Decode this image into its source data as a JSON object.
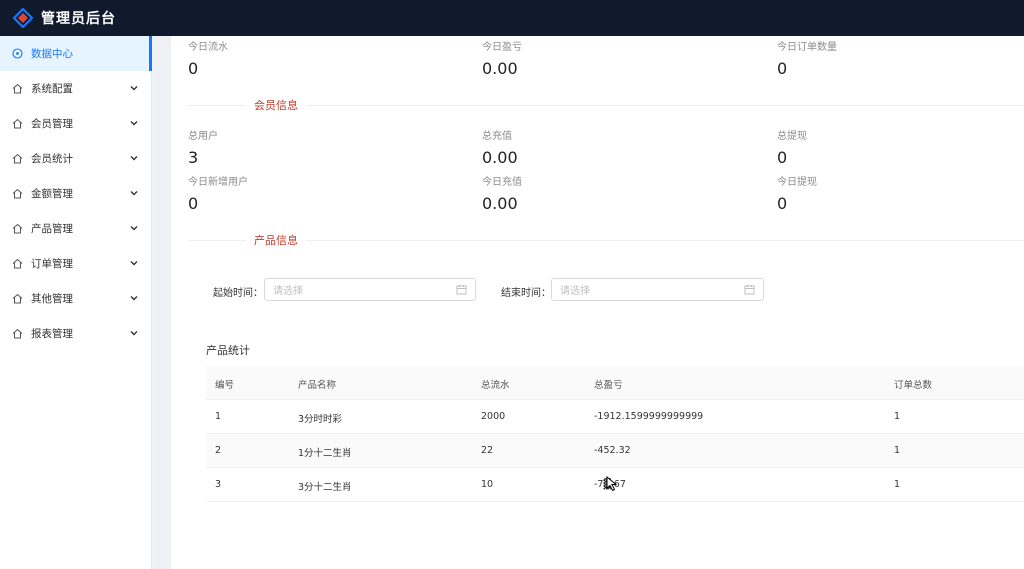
{
  "app": {
    "title": "管理员后台"
  },
  "sidebar": {
    "items": [
      {
        "label": "数据中心",
        "icon": "dashboard-icon",
        "active": true
      },
      {
        "label": "系统配置",
        "icon": "home-icon"
      },
      {
        "label": "会员管理",
        "icon": "home-icon"
      },
      {
        "label": "会员统计",
        "icon": "home-icon"
      },
      {
        "label": "金额管理",
        "icon": "home-icon"
      },
      {
        "label": "产品管理",
        "icon": "home-icon"
      },
      {
        "label": "订单管理",
        "icon": "home-icon"
      },
      {
        "label": "其他管理",
        "icon": "home-icon"
      },
      {
        "label": "报表管理",
        "icon": "home-icon"
      }
    ]
  },
  "today": {
    "flow_label": "今日流水",
    "flow_value": "0",
    "profit_label": "今日盈亏",
    "profit_value": "0.00",
    "orders_label": "今日订单数量",
    "orders_value": "0"
  },
  "member_section": {
    "title": "会员信息"
  },
  "members": {
    "total_users_label": "总用户",
    "total_users_value": "3",
    "total_recharge_label": "总充值",
    "total_recharge_value": "0.00",
    "total_withdraw_label": "总提现",
    "total_withdraw_value": "0",
    "today_new_label": "今日新增用户",
    "today_new_value": "0",
    "today_recharge_label": "今日充值",
    "today_recharge_value": "0.00",
    "today_withdraw_label": "今日提现",
    "today_withdraw_value": "0"
  },
  "product_section": {
    "title": "产品信息"
  },
  "filters": {
    "start_label": "起始时间：",
    "start_placeholder": "请选择",
    "end_label": "结束时间：",
    "end_placeholder": "请选择"
  },
  "product_stats": {
    "title": "产品统计",
    "columns": [
      "编号",
      "产品名称",
      "总流水",
      "总盈亏",
      "订单总数"
    ],
    "rows": [
      [
        "1",
        "3分时时彩",
        "2000",
        "-1912.1599999999999",
        "1"
      ],
      [
        "2",
        "1分十二生肖",
        "22",
        "-452.32",
        "1"
      ],
      [
        "3",
        "3分十二生肖",
        "10",
        "-7▓.67",
        "1"
      ]
    ]
  },
  "colors": {
    "topbar": "#101a2c",
    "accent": "#1677ff",
    "section_title": "#c0392b"
  }
}
